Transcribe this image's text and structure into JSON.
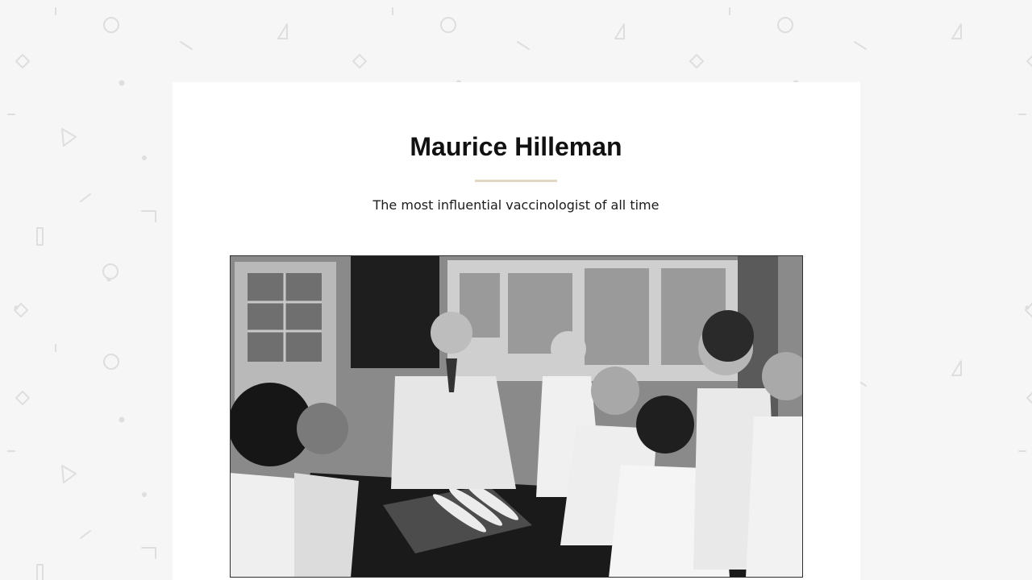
{
  "page": {
    "title": "Maurice Hilleman",
    "subtitle": "The most influential vaccinologist of all time"
  },
  "hero_image": {
    "alt": "Maurice Hilleman",
    "colors": {
      "background": "#f6f6f6",
      "card": "#ffffff",
      "accent_divider": "#e3d7c4",
      "title": "#111111"
    }
  }
}
